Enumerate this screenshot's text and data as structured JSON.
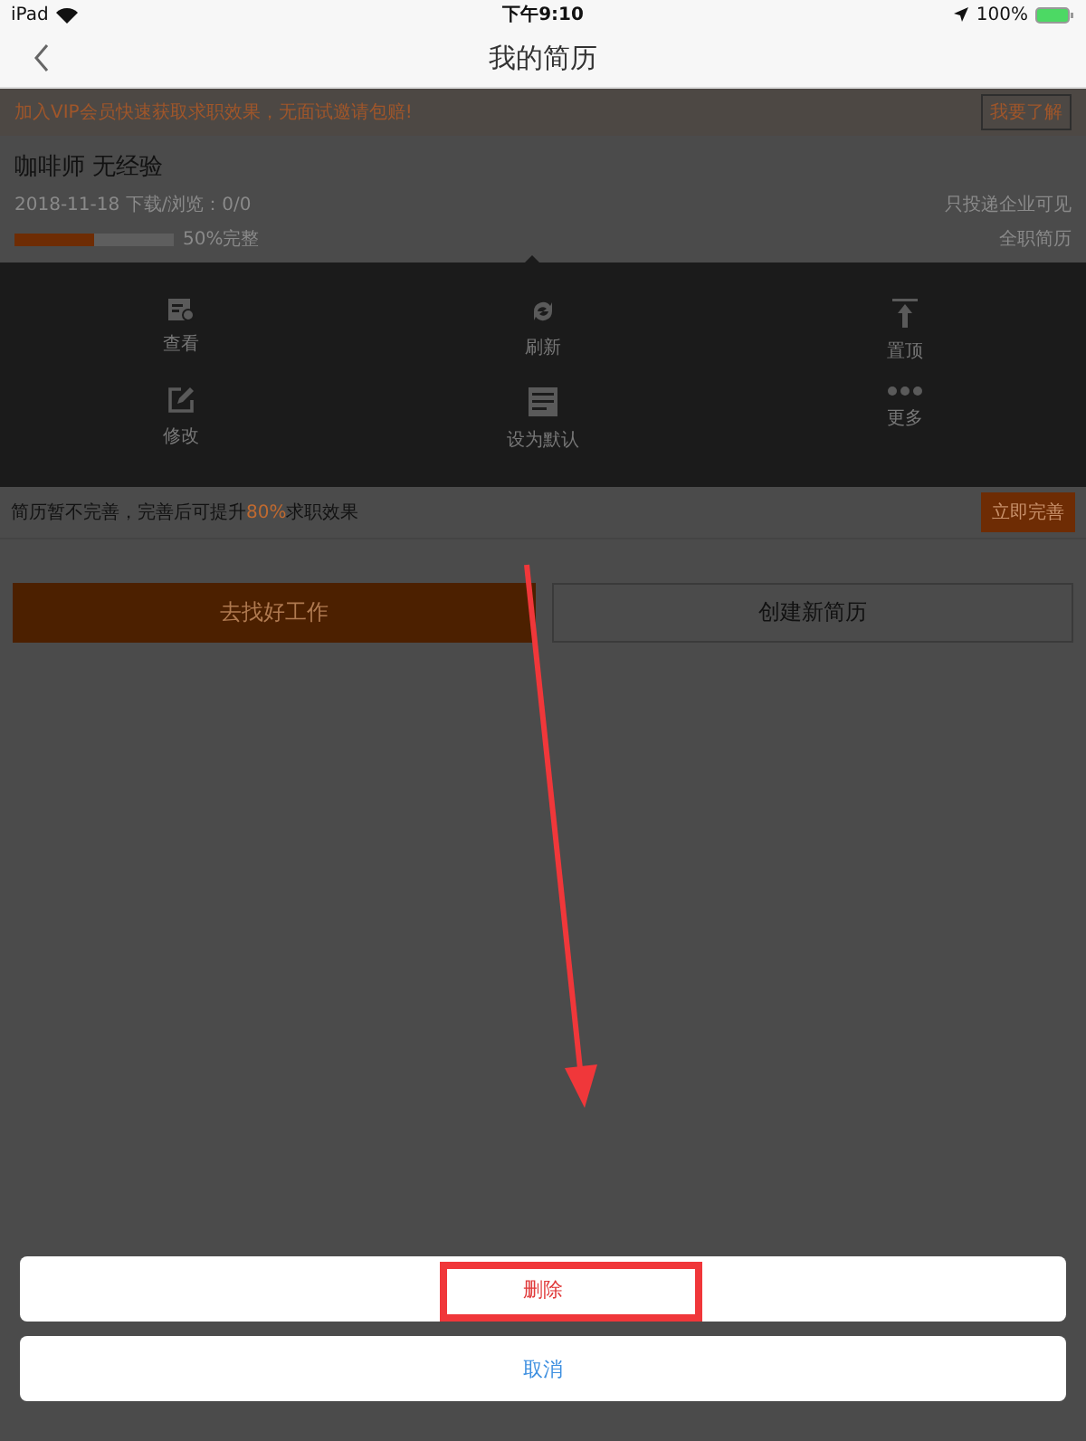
{
  "status_bar": {
    "device": "iPad",
    "time": "下午9:10",
    "battery": "100%"
  },
  "nav": {
    "title": "我的简历"
  },
  "vip_banner": {
    "text": "加入VIP会员快速获取求职效果，无面试邀请包赔!",
    "button": "我要了解"
  },
  "resume": {
    "title": "咖啡师 无经验",
    "meta": "2018-11-18  下载/浏览：0/0",
    "visibility": "只投递企业可见",
    "type": "全职简历",
    "level": 0.5,
    "completeness": "50%完整"
  },
  "actions": [
    {
      "kind": "view",
      "label": "查看"
    },
    {
      "kind": "refresh",
      "label": "刷新"
    },
    {
      "kind": "top",
      "label": "置顶"
    },
    {
      "kind": "edit",
      "label": "修改"
    },
    {
      "kind": "default",
      "label": "设为默认"
    },
    {
      "kind": "more",
      "label": "更多"
    }
  ],
  "tip": {
    "before": "简历暂不完善，完善后可提升",
    "highlight": "80%",
    "after": "求职效果",
    "button": "立即完善"
  },
  "buttons": [
    {
      "label": "去找好工作",
      "selected": true
    },
    {
      "label": "创建新简历",
      "selected": false
    }
  ],
  "sheet": [
    {
      "label": "删除",
      "kind": "destructive"
    },
    {
      "label": "取消",
      "kind": "cancel"
    }
  ]
}
